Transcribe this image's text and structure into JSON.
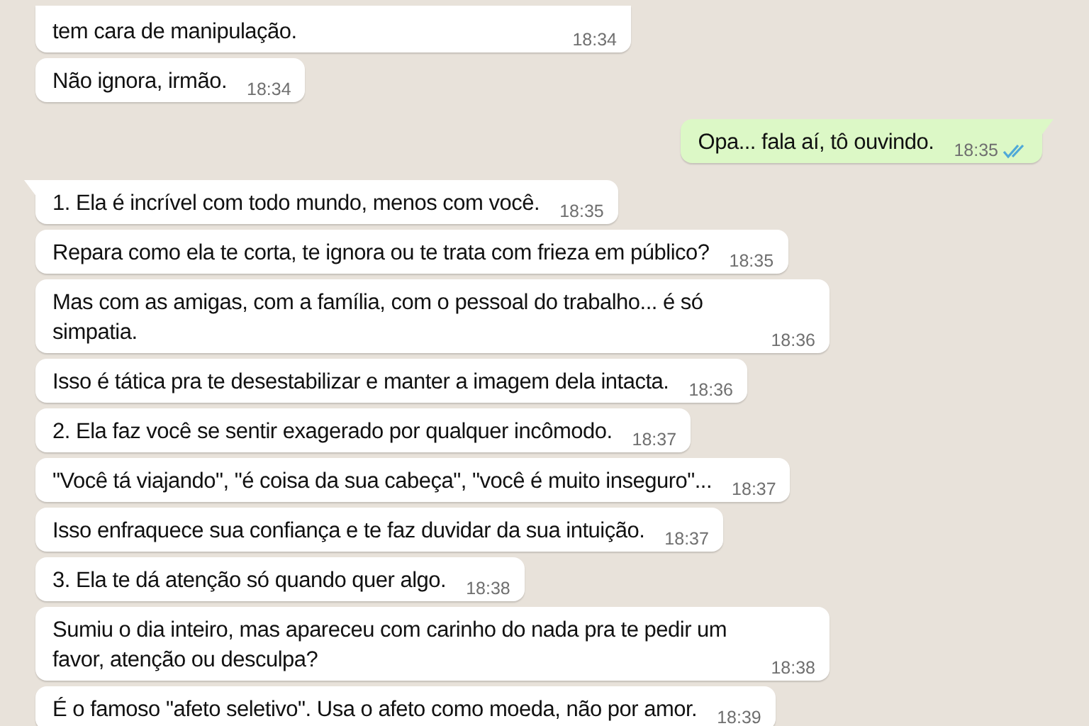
{
  "messages": [
    {
      "kind": "incoming",
      "text": "tem cara de manipulação.",
      "time": "18:34",
      "tail": false
    },
    {
      "kind": "incoming",
      "text": "Não ignora, irmão.",
      "time": "18:34",
      "tail": false
    },
    {
      "kind": "outgoing",
      "text": "Opa... fala aí, tô ouvindo.",
      "time": "18:35",
      "tail": true,
      "read": true
    },
    {
      "kind": "incoming",
      "text": "1. Ela é incrível com todo mundo, menos com você.",
      "time": "18:35",
      "tail": true
    },
    {
      "kind": "incoming",
      "text": "Repara como ela te corta, te ignora ou te trata com frieza em público?",
      "time": "18:35",
      "tail": false
    },
    {
      "kind": "incoming",
      "text": "Mas com as amigas, com a família, com o pessoal do trabalho... é só simpatia.",
      "time": "18:36",
      "tail": false
    },
    {
      "kind": "incoming",
      "text": "Isso é tática pra te desestabilizar e manter a imagem dela intacta.",
      "time": "18:36",
      "tail": false
    },
    {
      "kind": "incoming",
      "text": "2. Ela faz você se sentir exagerado por qualquer incômodo.",
      "time": "18:37",
      "tail": false
    },
    {
      "kind": "incoming",
      "text": "\"Você tá viajando\", \"é coisa da sua cabeça\", \"você é muito inseguro\"...",
      "time": "18:37",
      "tail": false
    },
    {
      "kind": "incoming",
      "text": "Isso enfraquece sua confiança e te faz duvidar da sua intuição.",
      "time": "18:37",
      "tail": false
    },
    {
      "kind": "incoming",
      "text": "3. Ela te dá atenção só quando quer algo.",
      "time": "18:38",
      "tail": false
    },
    {
      "kind": "incoming",
      "text": "Sumiu o dia inteiro, mas apareceu com carinho do nada pra te pedir um favor, atenção ou desculpa?",
      "time": "18:38",
      "tail": false
    },
    {
      "kind": "incoming",
      "text": "É o famoso \"afeto seletivo\". Usa o afeto como moeda, não por amor.",
      "time": "18:39",
      "tail": false
    }
  ]
}
